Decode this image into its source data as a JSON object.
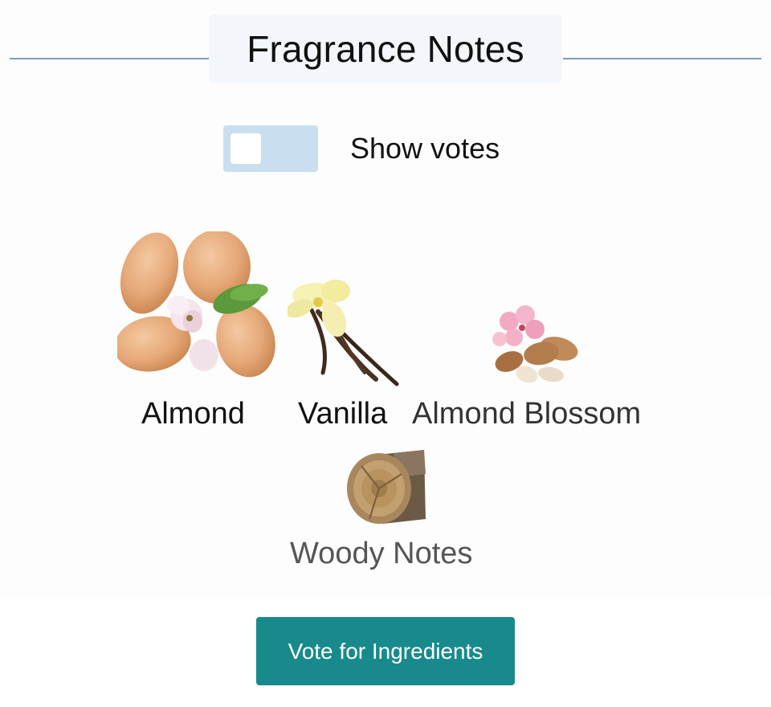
{
  "header": {
    "title": "Fragrance Notes"
  },
  "toggle": {
    "label": "Show votes",
    "checked": false
  },
  "notes": [
    {
      "name": "Almond",
      "icon": "almond-image",
      "label_color": "#111111"
    },
    {
      "name": "Vanilla",
      "icon": "vanilla-image",
      "label_color": "#111111"
    },
    {
      "name": "Almond Blossom",
      "icon": "almond-blossom-image",
      "label_color": "#333333"
    },
    {
      "name": "Woody Notes",
      "icon": "woody-notes-image",
      "label_color": "#555555"
    }
  ],
  "action": {
    "vote_label": "Vote for Ingredients"
  },
  "colors": {
    "accent": "#198a8c",
    "toggle_bg": "#c9dff0",
    "rule": "#7e9cbf"
  }
}
